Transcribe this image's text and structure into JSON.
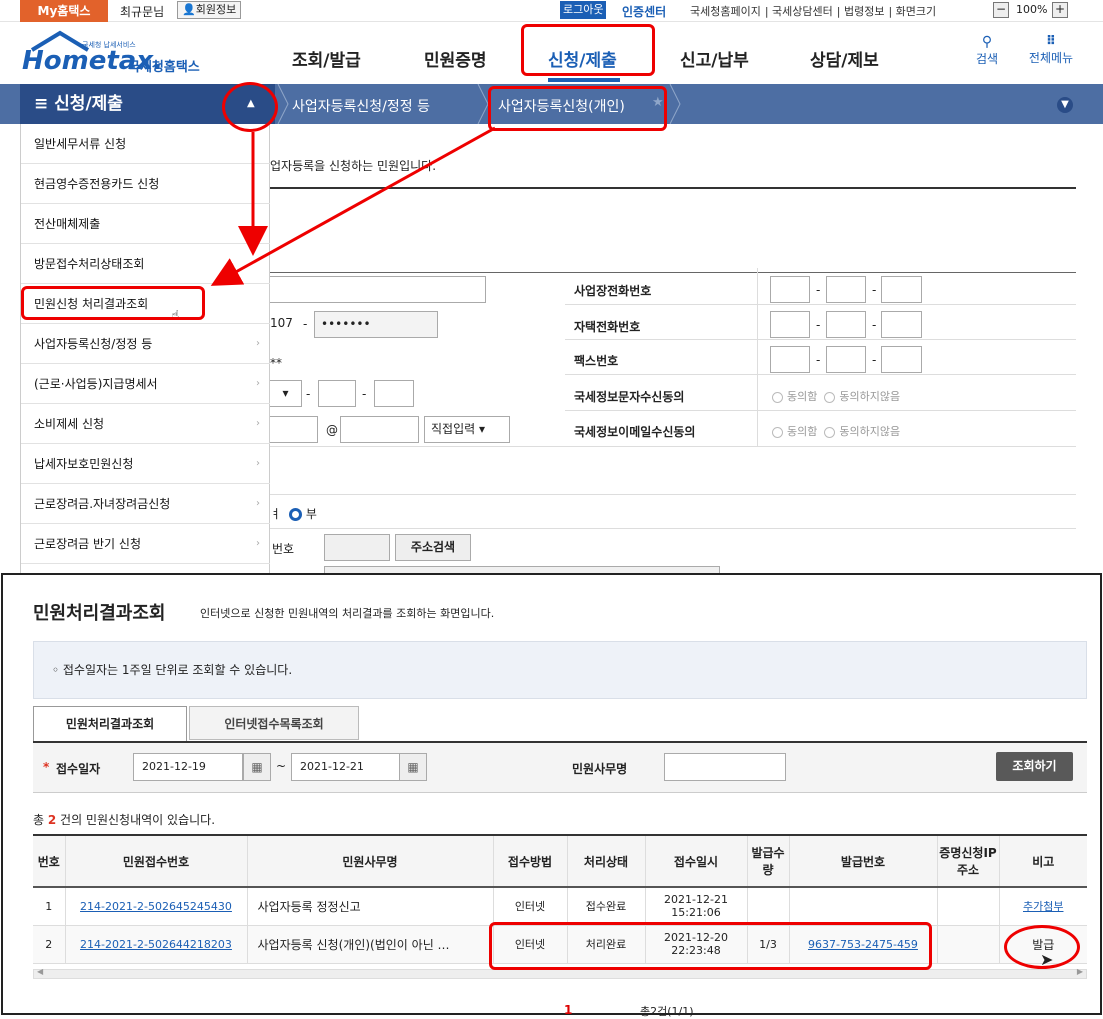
{
  "topbar": {
    "my_tab": "My홈택스",
    "greeting": "최규문님",
    "member_info": "회원정보",
    "logout": "로그아웃",
    "cert_center": "인증센터",
    "links": [
      "국세청홈페이지",
      "국세상담센터",
      "법령정보",
      "화면크기"
    ],
    "zoom_minus": "−",
    "zoom_value": "100%",
    "zoom_plus": "+"
  },
  "header": {
    "logo_text": "Hometax.",
    "logo_sub": "국세청홈택스",
    "logo_small": "국세청 납세서비스",
    "nav": [
      "조회/발급",
      "민원증명",
      "신청/제출",
      "신고/납부",
      "상담/제보"
    ],
    "search": "검색",
    "all_menu": "전체메뉴"
  },
  "menubar": {
    "title": "≡ 신청/제출",
    "crumb1": "사업자등록신청/정정 등",
    "crumb2": "사업자등록신청(개인)"
  },
  "sidebar": {
    "items": [
      "일반세무서류 신청",
      "현금영수증전용카드 신청",
      "전산매체제출",
      "방문접수처리상태조회",
      "민원신청 처리결과조회",
      "사업자등록신청/정정 등",
      "(근로·사업등)지급명세서",
      "소비제세 신청",
      "납세자보호민원신청",
      "근로장려금.자녀장려금신청",
      "근로장려금 반기 신청"
    ]
  },
  "bgform": {
    "intro": "업자등록을 신청하는 민원입니다.",
    "field_a": "107",
    "field_b": "•••••••",
    "mask": "**",
    "labels": [
      "사업장전화번호",
      "자택전화번호",
      "팩스번호",
      "국세정보문자수신동의",
      "국세정보이메일수신동의"
    ],
    "agree": "동의함",
    "disagree": "동의하지않음",
    "email_at": "@",
    "email_select": "직접입력",
    "radio_no": "부",
    "addr_label": "번호",
    "addr_btn": "주소검색"
  },
  "lower": {
    "title": "민원처리결과조회",
    "desc": "인터넷으로 신청한 민원내역의 처리결과를 조회하는 화면입니다.",
    "notice": "◦ 접수일자는 1주일 단위로 조회할 수 있습니다.",
    "tabs": [
      "민원처리결과조회",
      "인터넷접수목록조회"
    ],
    "search": {
      "required_mark": "*",
      "date_label": "접수일자",
      "date_from": "2021-12-19",
      "tilde": "~",
      "date_to": "2021-12-21",
      "name_label": "민원사무명",
      "button": "조회하기"
    },
    "count_pre": "총 ",
    "count_num": "2",
    "count_post": "건의 민원신청내역이 있습니다.",
    "columns": [
      "번호",
      "민원접수번호",
      "민원사무명",
      "접수방법",
      "처리상태",
      "접수일시",
      "발급수량",
      "발급번호",
      "증명신청IP주소",
      "비고"
    ],
    "rows": [
      {
        "no": "1",
        "receipt": "214-2021-2-502645245430",
        "name": "사업자등록 정정신고",
        "method": "인터넷",
        "status": "접수완료",
        "date": "2021-12-21",
        "time": "15:21:06",
        "qty": "",
        "issue_no": "",
        "ip": "",
        "note": "추가첨부"
      },
      {
        "no": "2",
        "receipt": "214-2021-2-502644218203",
        "name": "사업자등록 신청(개인)(법인이 아닌 …",
        "method": "인터넷",
        "status": "처리완료",
        "date": "2021-12-20",
        "time": "22:23:48",
        "qty": "1/3",
        "issue_no": "9637-753-2475-459",
        "ip": "",
        "note": "발급"
      }
    ],
    "pager_current": "1",
    "pager_total": "총2건(1/1)"
  },
  "colors": {
    "brand": "#1b5fb5",
    "menubar": "#4d6ea3",
    "menubar_dark": "#2a4c87",
    "annotation": "#e00000",
    "my_tab": "#e2622b"
  }
}
